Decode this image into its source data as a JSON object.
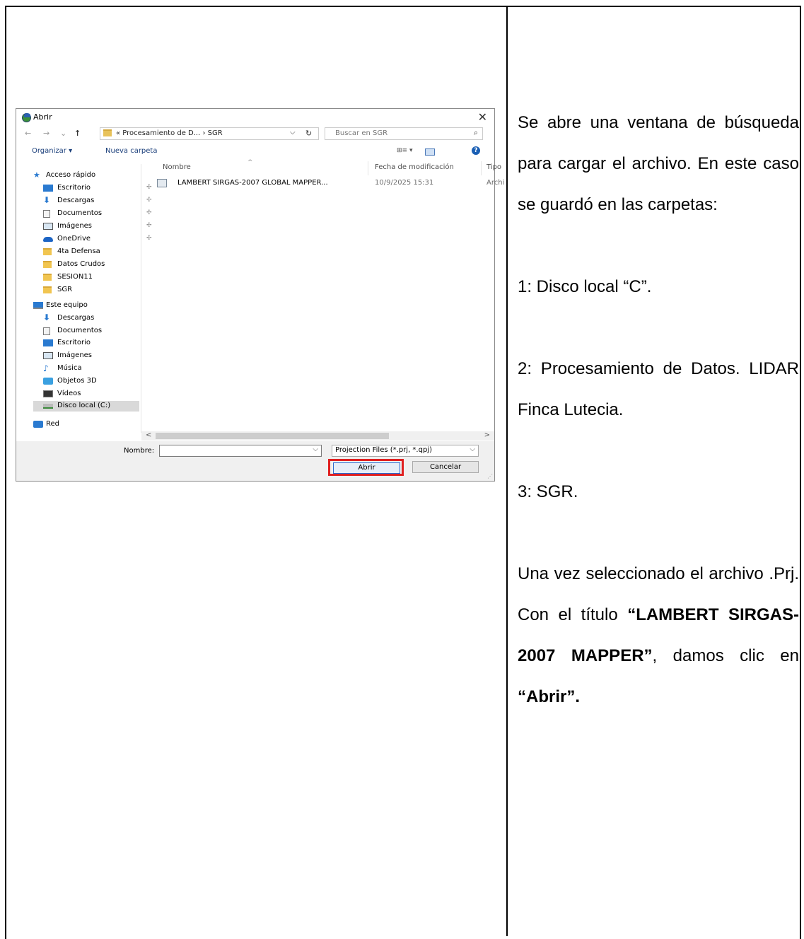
{
  "dialog": {
    "title": "Abrir",
    "close_glyph": "✕",
    "nav_back": "←",
    "nav_forward": "→",
    "nav_recent": "⌄",
    "nav_up": "↑",
    "address": "« Procesamiento de D...  ›  SGR",
    "search_placeholder": "Buscar en SGR",
    "toolbar": {
      "organize": "Organizar ▾",
      "new_folder": "Nueva carpeta",
      "view_glyph": "⊞≡ ▾",
      "help_glyph": "?"
    },
    "nav_quick": [
      {
        "label": "Acceso rápido",
        "icon": "star-icon"
      },
      {
        "label": "Escritorio",
        "icon": "desktop-icon",
        "pin": true
      },
      {
        "label": "Descargas",
        "icon": "download-icon",
        "pin": true
      },
      {
        "label": "Documentos",
        "icon": "documents-icon",
        "pin": true
      },
      {
        "label": "Imágenes",
        "icon": "pictures-icon",
        "pin": true
      },
      {
        "label": "OneDrive",
        "icon": "cloud-icon",
        "pin": true
      },
      {
        "label": "4ta Defensa",
        "icon": "folder-icon"
      },
      {
        "label": "Datos Crudos",
        "icon": "folder-icon"
      },
      {
        "label": "SESION11",
        "icon": "folder-icon"
      },
      {
        "label": "SGR",
        "icon": "folder-icon"
      }
    ],
    "nav_pc": [
      {
        "label": "Este equipo",
        "icon": "computer-icon"
      },
      {
        "label": "Descargas",
        "icon": "download-icon"
      },
      {
        "label": "Documentos",
        "icon": "documents-icon"
      },
      {
        "label": "Escritorio",
        "icon": "desktop-icon"
      },
      {
        "label": "Imágenes",
        "icon": "pictures-icon"
      },
      {
        "label": "Música",
        "icon": "music-icon"
      },
      {
        "label": "Objetos 3D",
        "icon": "objects-3d-icon"
      },
      {
        "label": "Vídeos",
        "icon": "video-icon"
      },
      {
        "label": "Disco local (C:)",
        "icon": "drive-icon",
        "selected": true
      }
    ],
    "nav_network": {
      "label": "Red",
      "icon": "network-icon"
    },
    "columns": {
      "name": "Nombre",
      "modified": "Fecha de modificación",
      "type": "Tipo"
    },
    "files": [
      {
        "name": "LAMBERT SIRGAS-2007 GLOBAL MAPPER...",
        "modified": "10/9/2025 15:31",
        "type": "Archi"
      }
    ],
    "scroll_left": "<",
    "scroll_right": ">",
    "filename_label": "Nombre:",
    "filename_value": "",
    "filter": "Projection Files (*.prj, *.qpj)",
    "dropdown_glyph": "⌵",
    "open_button": "Abrir",
    "cancel_button": "Cancelar"
  },
  "description": {
    "p1": "Se abre una ventana de búsqueda para cargar el archivo. En este caso se guardó en las carpetas:",
    "p2": "1: Disco local “C”.",
    "p3": "2: Procesamiento de Datos. LIDAR Finca Lutecia.",
    "p4": "3: SGR.",
    "p5_a": "Una vez seleccionado el archivo .Prj. Con el título ",
    "p5_b": "“LAMBERT SIRGAS-2007 MAPPER”",
    "p5_c": ", damos clic en ",
    "p5_d": "“Abrir”."
  }
}
